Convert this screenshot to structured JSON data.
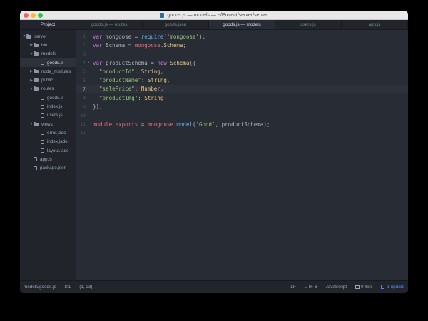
{
  "window": {
    "title": "goods.js — models — ~/Project/server/server"
  },
  "sidebar": {
    "header": "Project",
    "tree": [
      {
        "type": "folder",
        "open": true,
        "depth": 0,
        "label": "server"
      },
      {
        "type": "folder",
        "open": false,
        "depth": 1,
        "label": "bin"
      },
      {
        "type": "folder",
        "open": true,
        "depth": 1,
        "label": "models"
      },
      {
        "type": "file",
        "depth": 2,
        "label": "goods.js",
        "selected": true
      },
      {
        "type": "folder",
        "open": false,
        "depth": 1,
        "label": "node_modules"
      },
      {
        "type": "folder",
        "open": false,
        "depth": 1,
        "label": "public"
      },
      {
        "type": "folder",
        "open": true,
        "depth": 1,
        "label": "routes"
      },
      {
        "type": "file",
        "depth": 2,
        "label": "goods.js"
      },
      {
        "type": "file",
        "depth": 2,
        "label": "index.js"
      },
      {
        "type": "file",
        "depth": 2,
        "label": "users.js"
      },
      {
        "type": "folder",
        "open": true,
        "depth": 1,
        "label": "views"
      },
      {
        "type": "file",
        "depth": 2,
        "label": "error.jade"
      },
      {
        "type": "file",
        "depth": 2,
        "label": "index.jade"
      },
      {
        "type": "file",
        "depth": 2,
        "label": "layout.jade"
      },
      {
        "type": "file",
        "depth": 1,
        "label": "app.js"
      },
      {
        "type": "file",
        "depth": 1,
        "label": "package.json"
      }
    ]
  },
  "tabs": [
    {
      "label": "goods.js — routes",
      "active": false
    },
    {
      "label": "goods.json",
      "active": false
    },
    {
      "label": "goods.js — models",
      "active": true
    },
    {
      "label": "users.js",
      "active": false
    },
    {
      "label": "app.js",
      "active": false
    }
  ],
  "editor": {
    "cursor_line": 7,
    "lines": [
      {
        "n": "1",
        "fold": "",
        "tokens": [
          [
            "kw",
            "var"
          ],
          [
            "plain",
            " mongoose = "
          ],
          [
            "fn",
            "require"
          ],
          [
            "plain",
            "("
          ],
          [
            "str",
            "'mongoose'"
          ],
          [
            "plain",
            ");"
          ]
        ]
      },
      {
        "n": "2",
        "fold": "",
        "tokens": [
          [
            "kw",
            "var"
          ],
          [
            "plain",
            " Schema = "
          ],
          [
            "var",
            "mongoose"
          ],
          [
            "plain",
            "."
          ],
          [
            "cls",
            "Schema"
          ],
          [
            "plain",
            ";"
          ]
        ]
      },
      {
        "n": "3",
        "fold": "",
        "tokens": []
      },
      {
        "n": "4",
        "fold": "▾",
        "tokens": [
          [
            "kw",
            "var"
          ],
          [
            "plain",
            " productSchema = "
          ],
          [
            "kw",
            "new"
          ],
          [
            "plain",
            " "
          ],
          [
            "cls",
            "Schema"
          ],
          [
            "plain",
            "({"
          ]
        ]
      },
      {
        "n": "5",
        "fold": "",
        "tokens": [
          [
            "plain",
            "  "
          ],
          [
            "str",
            "\"productId\""
          ],
          [
            "plain",
            ": "
          ],
          [
            "cls",
            "String"
          ],
          [
            "plain",
            ","
          ]
        ]
      },
      {
        "n": "6",
        "fold": "",
        "tokens": [
          [
            "plain",
            "  "
          ],
          [
            "str",
            "\"productName\""
          ],
          [
            "plain",
            ": "
          ],
          [
            "cls",
            "String"
          ],
          [
            "plain",
            ","
          ]
        ]
      },
      {
        "n": "7",
        "fold": "",
        "tokens": [
          [
            "plain",
            "  "
          ],
          [
            "str",
            "\"salePrice\""
          ],
          [
            "plain",
            ": "
          ],
          [
            "cls",
            "Number"
          ],
          [
            "plain",
            ","
          ]
        ]
      },
      {
        "n": "8",
        "fold": "",
        "tokens": [
          [
            "plain",
            "  "
          ],
          [
            "str",
            "\"productImg\""
          ],
          [
            "plain",
            ": "
          ],
          [
            "cls",
            "String"
          ]
        ]
      },
      {
        "n": "9",
        "fold": "",
        "tokens": [
          [
            "plain",
            "});"
          ]
        ]
      },
      {
        "n": "10",
        "fold": "",
        "tokens": []
      },
      {
        "n": "11",
        "fold": "",
        "tokens": [
          [
            "var",
            "module"
          ],
          [
            "plain",
            "."
          ],
          [
            "var",
            "exports"
          ],
          [
            "plain",
            " = "
          ],
          [
            "var",
            "mongoose"
          ],
          [
            "plain",
            "."
          ],
          [
            "fn",
            "model"
          ],
          [
            "plain",
            "("
          ],
          [
            "str",
            "'Good'"
          ],
          [
            "plain",
            ", productSchema);"
          ]
        ]
      },
      {
        "n": "12",
        "fold": "",
        "tokens": []
      }
    ]
  },
  "statusbar": {
    "file_path": "models/goods.js",
    "position": "8:1",
    "selection": "(1, 23)",
    "line_ending": "LF",
    "encoding": "UTF-8",
    "grammar": "JavaScript",
    "files": "0 files",
    "update": "1 update"
  },
  "colors": {
    "background": "#282c34",
    "sidebar": "#21252b",
    "keyword": "#c678dd",
    "function": "#61afef",
    "string": "#98c379",
    "class": "#e5c07b",
    "variable": "#e06c75",
    "accent": "#568af2"
  }
}
